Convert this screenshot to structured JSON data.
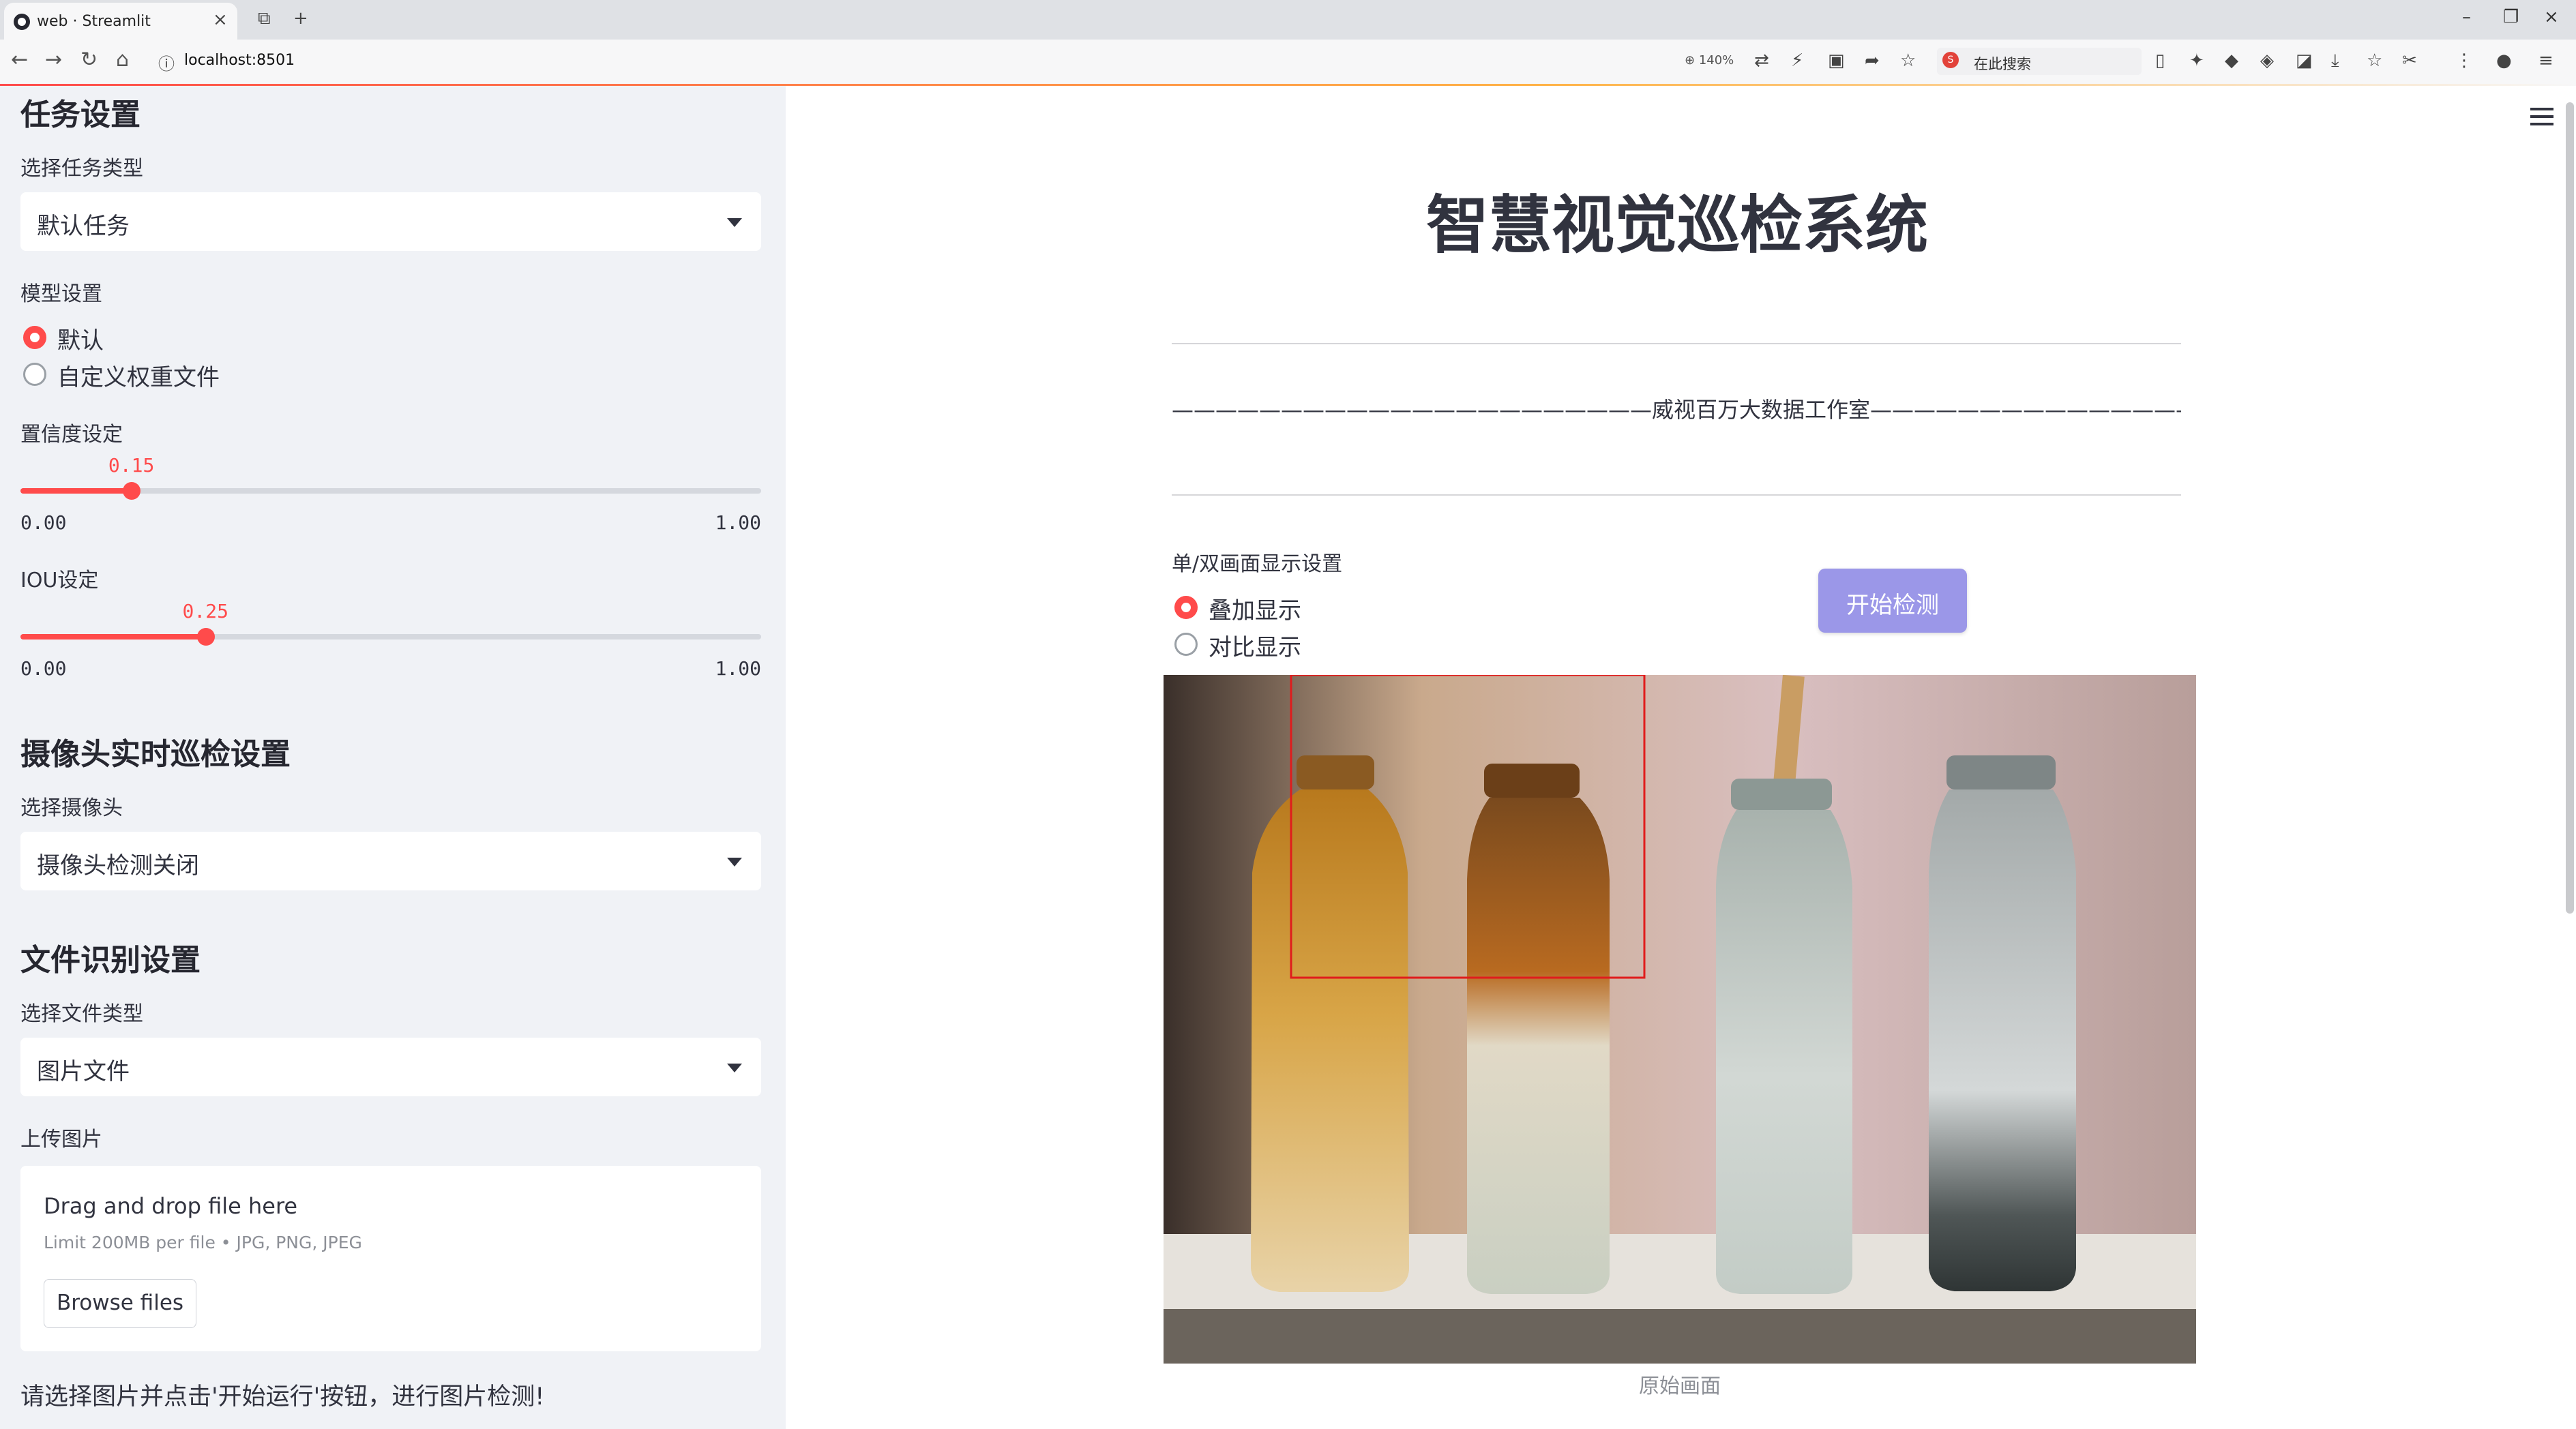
{
  "browser": {
    "tab_title": "web · Streamlit",
    "url": "localhost:8501",
    "zoom": "140%",
    "search_placeholder": "在此搜索"
  },
  "sidebar": {
    "task_header": "任务设置",
    "task_type_label": "选择任务类型",
    "task_type_value": "默认任务",
    "model_label": "模型设置",
    "model_options": [
      "默认",
      "自定义权重文件"
    ],
    "model_selected": "默认",
    "confidence_label": "置信度设定",
    "confidence": {
      "value": 0.15,
      "value_text": "0.15",
      "min": "0.00",
      "max": "1.00"
    },
    "iou_label": "IOU设定",
    "iou": {
      "value": 0.25,
      "value_text": "0.25",
      "min": "0.00",
      "max": "1.00"
    },
    "camera_header": "摄像头实时巡检设置",
    "camera_label": "选择摄像头",
    "camera_value": "摄像头检测关闭",
    "file_header": "文件识别设置",
    "file_type_label": "选择文件类型",
    "file_type_value": "图片文件",
    "upload_label": "上传图片",
    "uploader": {
      "title": "Drag and drop file here",
      "limit": "Limit 200MB per file • JPG, PNG, JPEG",
      "button": "Browse files"
    },
    "note": "请选择图片并点击'开始运行'按钮，进行图片检测!"
  },
  "main": {
    "title": "智慧视觉巡检系统",
    "subtitle": "——————————————————————威视百万大数据工作室———————————————————————",
    "display_label": "单/双画面显示设置",
    "display_options": [
      "叠加显示",
      "对比显示"
    ],
    "display_selected": "叠加显示",
    "start_button": "开始检测",
    "image_caption": "原始画面"
  },
  "colors": {
    "accent": "#ff4b4b",
    "button": "#9b97e8",
    "sidebar_bg": "#f0f2f6"
  }
}
